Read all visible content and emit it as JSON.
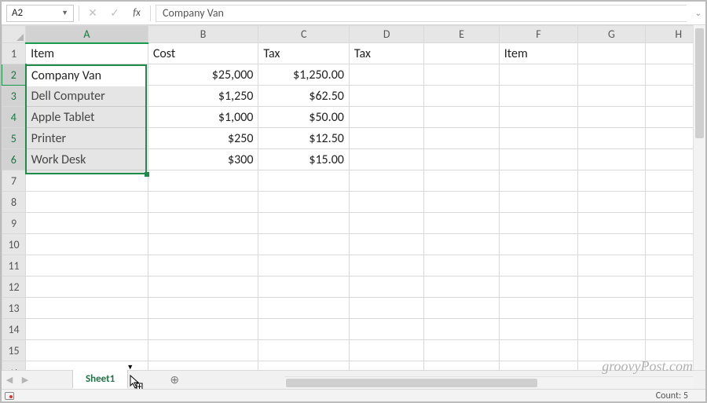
{
  "namebox": {
    "value": "A2"
  },
  "formula_bar": {
    "value": "Company Van"
  },
  "columns": [
    "A",
    "B",
    "C",
    "D",
    "E",
    "F",
    "G",
    "H"
  ],
  "row_count": 16,
  "headers": {
    "A": "Item",
    "B": "Cost",
    "C": "Tax",
    "D": "Tax",
    "F": "Item"
  },
  "rows": [
    {
      "item": "Company Van",
      "cost": "$25,000",
      "tax": "$1,250.00"
    },
    {
      "item": "Dell Computer",
      "cost": "$1,250",
      "tax": "$62.50"
    },
    {
      "item": "Apple Tablet",
      "cost": "$1,000",
      "tax": "$50.00"
    },
    {
      "item": "Printer",
      "cost": "$250",
      "tax": "$12.50"
    },
    {
      "item": "Work Desk",
      "cost": "$300",
      "tax": "$15.00"
    }
  ],
  "selection": {
    "range": "A2:A6",
    "active": "A2"
  },
  "tabs": {
    "active": "Sheet1"
  },
  "status": {
    "count_label": "Count:",
    "count_value": "5"
  },
  "watermark": "groovyPost.com",
  "chart_data": {
    "type": "table",
    "title": "",
    "columns": [
      "Item",
      "Cost",
      "Tax",
      "Tax",
      "",
      "Item"
    ],
    "data": [
      [
        "Company Van",
        25000,
        1250.0
      ],
      [
        "Dell Computer",
        1250,
        62.5
      ],
      [
        "Apple Tablet",
        1000,
        50.0
      ],
      [
        "Printer",
        250,
        12.5
      ],
      [
        "Work Desk",
        300,
        15.0
      ]
    ]
  }
}
